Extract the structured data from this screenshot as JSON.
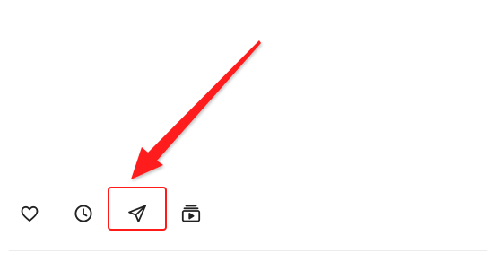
{
  "actions": [
    {
      "id": "like",
      "icon": "heart-icon"
    },
    {
      "id": "history",
      "icon": "clock-icon"
    },
    {
      "id": "share",
      "icon": "send-icon"
    },
    {
      "id": "watch",
      "icon": "playlist-play-icon"
    }
  ],
  "annotation": {
    "highlight_target": "share",
    "color": "#ff1a1a"
  },
  "colors": {
    "icon": "#222222",
    "background": "#ffffff",
    "divider": "#ececec"
  }
}
